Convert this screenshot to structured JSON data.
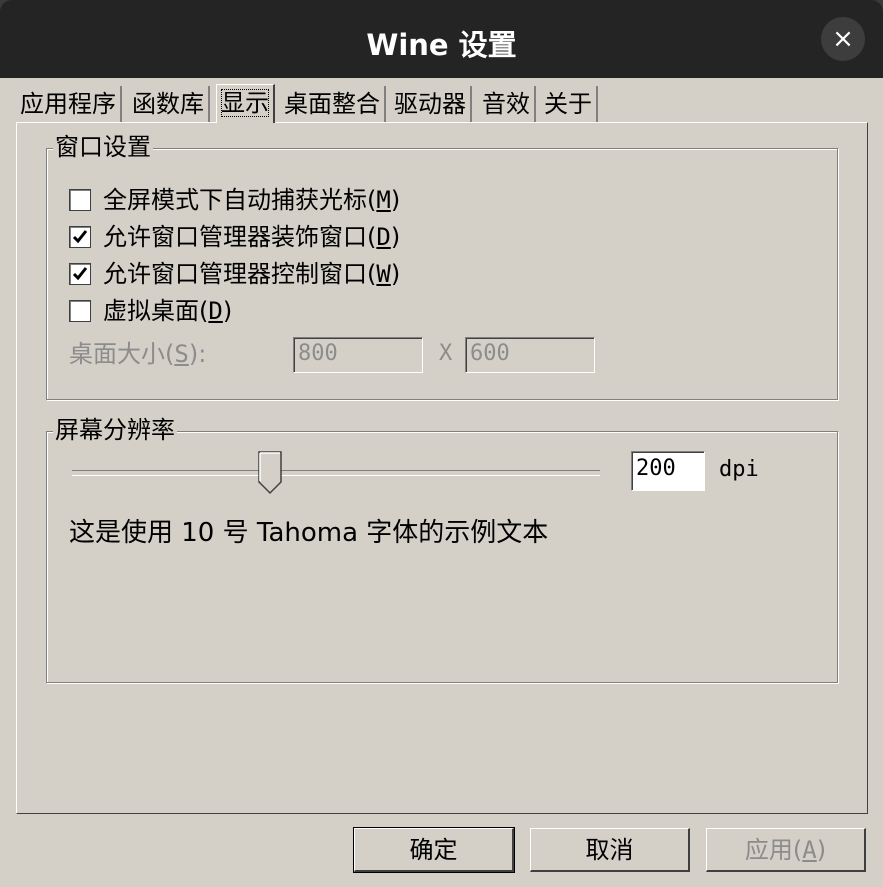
{
  "window": {
    "title": "Wine 设置",
    "close_icon": "×"
  },
  "tabs": [
    {
      "label": "应用程序"
    },
    {
      "label": "函数库"
    },
    {
      "label": "显示",
      "active": true
    },
    {
      "label": "桌面整合"
    },
    {
      "label": "驱动器"
    },
    {
      "label": "音效"
    },
    {
      "label": "关于"
    }
  ],
  "window_settings": {
    "group_label": "窗口设置",
    "options": [
      {
        "label": "全屏模式下自动捕获光标",
        "mnemonic": "M",
        "checked": false
      },
      {
        "label": "允许窗口管理器装饰窗口",
        "mnemonic": "D",
        "checked": true
      },
      {
        "label": "允许窗口管理器控制窗口",
        "mnemonic": "W",
        "checked": true
      },
      {
        "label": "虚拟桌面",
        "mnemonic": "D",
        "checked": false
      }
    ],
    "desktop_size_label": "桌面大小",
    "desktop_size_mnemonic": "S",
    "desktop_size_suffix": ":",
    "width_value": "800",
    "separator": "X",
    "height_value": "600"
  },
  "resolution": {
    "group_label": "屏幕分辨率",
    "dpi_value": "200",
    "dpi_unit": "dpi",
    "slider_level": 0.37,
    "sample_text": "这是使用 10 号 Tahoma 字体的示例文本"
  },
  "buttons": {
    "ok": "确定",
    "cancel": "取消",
    "apply_label": "应用",
    "apply_mnemonic": "A"
  },
  "colors": {
    "titlebar": "#242424",
    "dialog_bg": "#d4d0c8",
    "disabled_text": "#8c8c8c"
  }
}
